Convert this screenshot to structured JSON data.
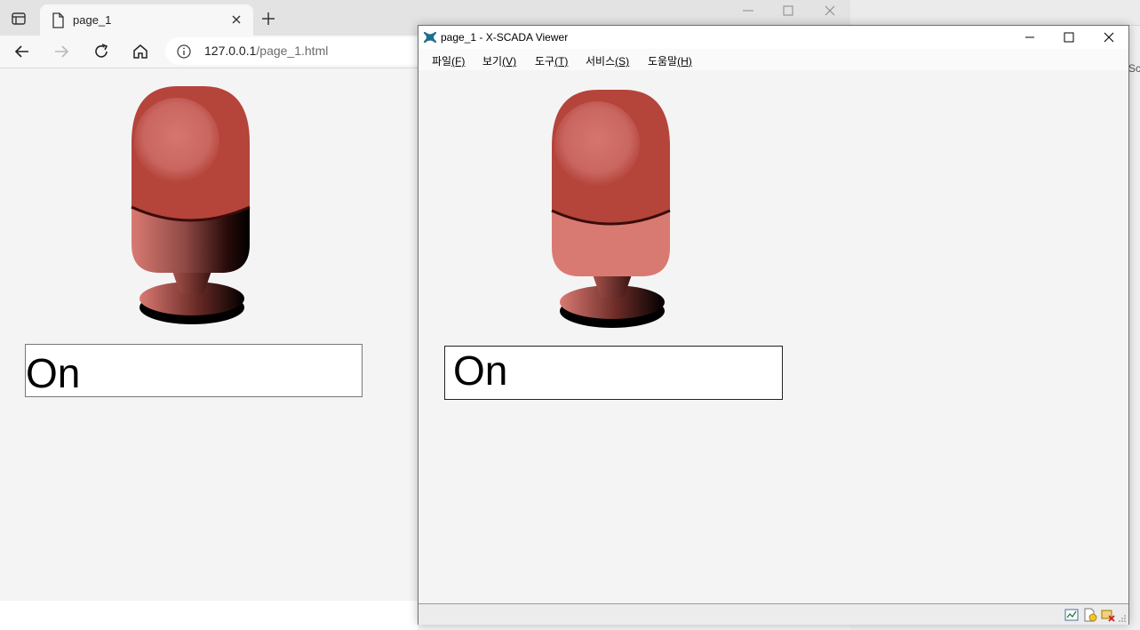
{
  "browser": {
    "tab_title": "page_1",
    "address_host": "127.0.0.1",
    "address_path": "/page_1.html",
    "content": {
      "status_text": "On"
    }
  },
  "viewer": {
    "title": "page_1 - X-SCADA Viewer",
    "menu": [
      {
        "label": "파일",
        "key": "(F)"
      },
      {
        "label": "보기",
        "key": "(V)"
      },
      {
        "label": "도구",
        "key": "(T)"
      },
      {
        "label": "서비스",
        "key": "(S)"
      },
      {
        "label": "도움말",
        "key": "(H)"
      }
    ],
    "content": {
      "status_text": "On"
    }
  },
  "other_window": {
    "sliver_text": "Sc"
  },
  "colors": {
    "lamp_red": "#b5443a",
    "lamp_light": "#d97a72",
    "viewer_app_icon": "#1f6f8f"
  }
}
